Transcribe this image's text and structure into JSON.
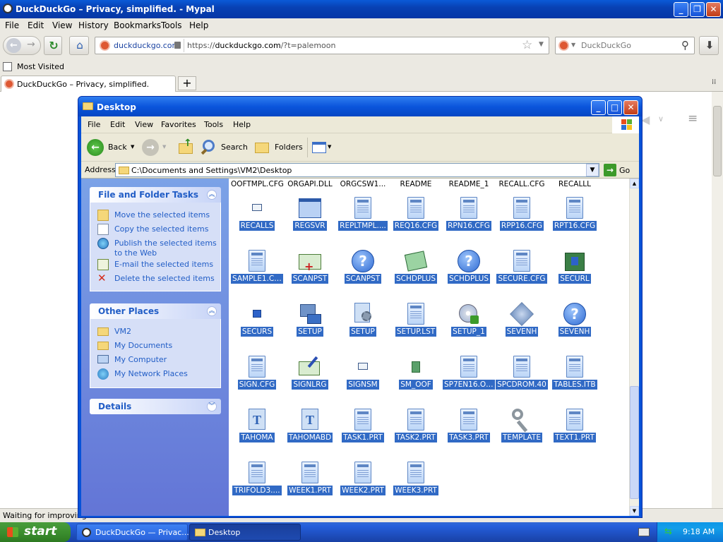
{
  "browser": {
    "title": "DuckDuckGo – Privacy, simplified. - Mypal",
    "menu": [
      "File",
      "Edit",
      "View",
      "History",
      "Bookmarks",
      "Tools",
      "Help"
    ],
    "site_identity": "duckduckgo.com",
    "url_prefix": "https://",
    "url_domain": "duckduckgo.com",
    "url_rest": "/?t=palemoon",
    "search_engine_placeholder": "DuckDuckGo",
    "bookmarks": [
      "Most Visited"
    ],
    "tab_title": "DuckDuckGo – Privacy, simplified.",
    "new_tab": "+",
    "status": "Waiting for improving.d"
  },
  "explorer": {
    "title": "Desktop",
    "menu": [
      "File",
      "Edit",
      "View",
      "Favorites",
      "Tools",
      "Help"
    ],
    "toolbar": {
      "back": "Back",
      "search": "Search",
      "folders": "Folders"
    },
    "address_label": "Address",
    "address_value": "C:\\Documents and Settings\\VM2\\Desktop",
    "go": "Go",
    "tasks": {
      "file_folder_title": "File and Folder Tasks",
      "file_folder_items": [
        "Move the selected items",
        "Copy the selected items",
        "Publish the selected items to the Web",
        "E-mail the selected items",
        "Delete the selected items"
      ],
      "other_places_title": "Other Places",
      "other_places_items": [
        "VM2",
        "My Documents",
        "My Computer",
        "My Network Places"
      ],
      "details_title": "Details"
    },
    "header_row": [
      "OOFTMPL.CFG",
      "ORGAPI.DLL",
      "ORGCSW1...",
      "README",
      "README_1",
      "RECALL.CFG",
      "RECALLL"
    ],
    "rows": [
      [
        {
          "label": "RECALLS",
          "icon": "small-envelope"
        },
        {
          "label": "REGSVR",
          "icon": "window"
        },
        {
          "label": "REPLTMPL....",
          "icon": "doc"
        },
        {
          "label": "REQ16.CFG",
          "icon": "doc"
        },
        {
          "label": "RPN16.CFG",
          "icon": "doc"
        },
        {
          "label": "RPP16.CFG",
          "icon": "doc"
        },
        {
          "label": "RPT16.CFG",
          "icon": "doc"
        }
      ],
      [
        {
          "label": "SAMPLE1.CWL",
          "icon": "doc"
        },
        {
          "label": "SCANPST",
          "icon": "envelope-plus"
        },
        {
          "label": "SCANPST",
          "icon": "help"
        },
        {
          "label": "SCHDPLUS",
          "icon": "calendar"
        },
        {
          "label": "SCHDPLUS",
          "icon": "help"
        },
        {
          "label": "SECURE.CFG",
          "icon": "doc"
        },
        {
          "label": "SECURL",
          "icon": "lock-book"
        }
      ],
      [
        {
          "label": "SECURS",
          "icon": "small-lock"
        },
        {
          "label": "SETUP",
          "icon": "setup"
        },
        {
          "label": "SETUP",
          "icon": "gear-doc"
        },
        {
          "label": "SETUP.LST",
          "icon": "doc"
        },
        {
          "label": "SETUP_1",
          "icon": "cd"
        },
        {
          "label": "SEVENH",
          "icon": "seven"
        },
        {
          "label": "SEVENH",
          "icon": "help"
        }
      ],
      [
        {
          "label": "SIGN.CFG",
          "icon": "doc"
        },
        {
          "label": "SIGNLRG",
          "icon": "envelope-pen"
        },
        {
          "label": "SIGNSM",
          "icon": "small-envelope"
        },
        {
          "label": "SM_OOF",
          "icon": "small-door"
        },
        {
          "label": "SP7EN16.OLB",
          "icon": "doc"
        },
        {
          "label": "SPCDROM.40",
          "icon": "doc"
        },
        {
          "label": "TABLES.ITB",
          "icon": "doc"
        }
      ],
      [
        {
          "label": "TAHOMA",
          "icon": "font"
        },
        {
          "label": "TAHOMABD",
          "icon": "font"
        },
        {
          "label": "TASK1.PRT",
          "icon": "doc"
        },
        {
          "label": "TASK2.PRT",
          "icon": "doc"
        },
        {
          "label": "TASK3.PRT",
          "icon": "doc"
        },
        {
          "label": "TEMPLATE",
          "icon": "key"
        },
        {
          "label": "TEXT1.PRT",
          "icon": "doc"
        }
      ],
      [
        {
          "label": "TRIFOLD3....",
          "icon": "doc"
        },
        {
          "label": "WEEK1.PRT",
          "icon": "doc"
        },
        {
          "label": "WEEK2.PRT",
          "icon": "doc"
        },
        {
          "label": "WEEK3.PRT",
          "icon": "doc"
        }
      ]
    ]
  },
  "taskbar": {
    "start": "start",
    "items": [
      "DuckDuckGo — Privac...",
      "Desktop"
    ],
    "clock": "9:18 AM"
  },
  "colors": {
    "xp_blue": "#0752d8",
    "selection": "#316ac5",
    "start_green": "#3c8f2f",
    "task_link": "#215dc6"
  }
}
